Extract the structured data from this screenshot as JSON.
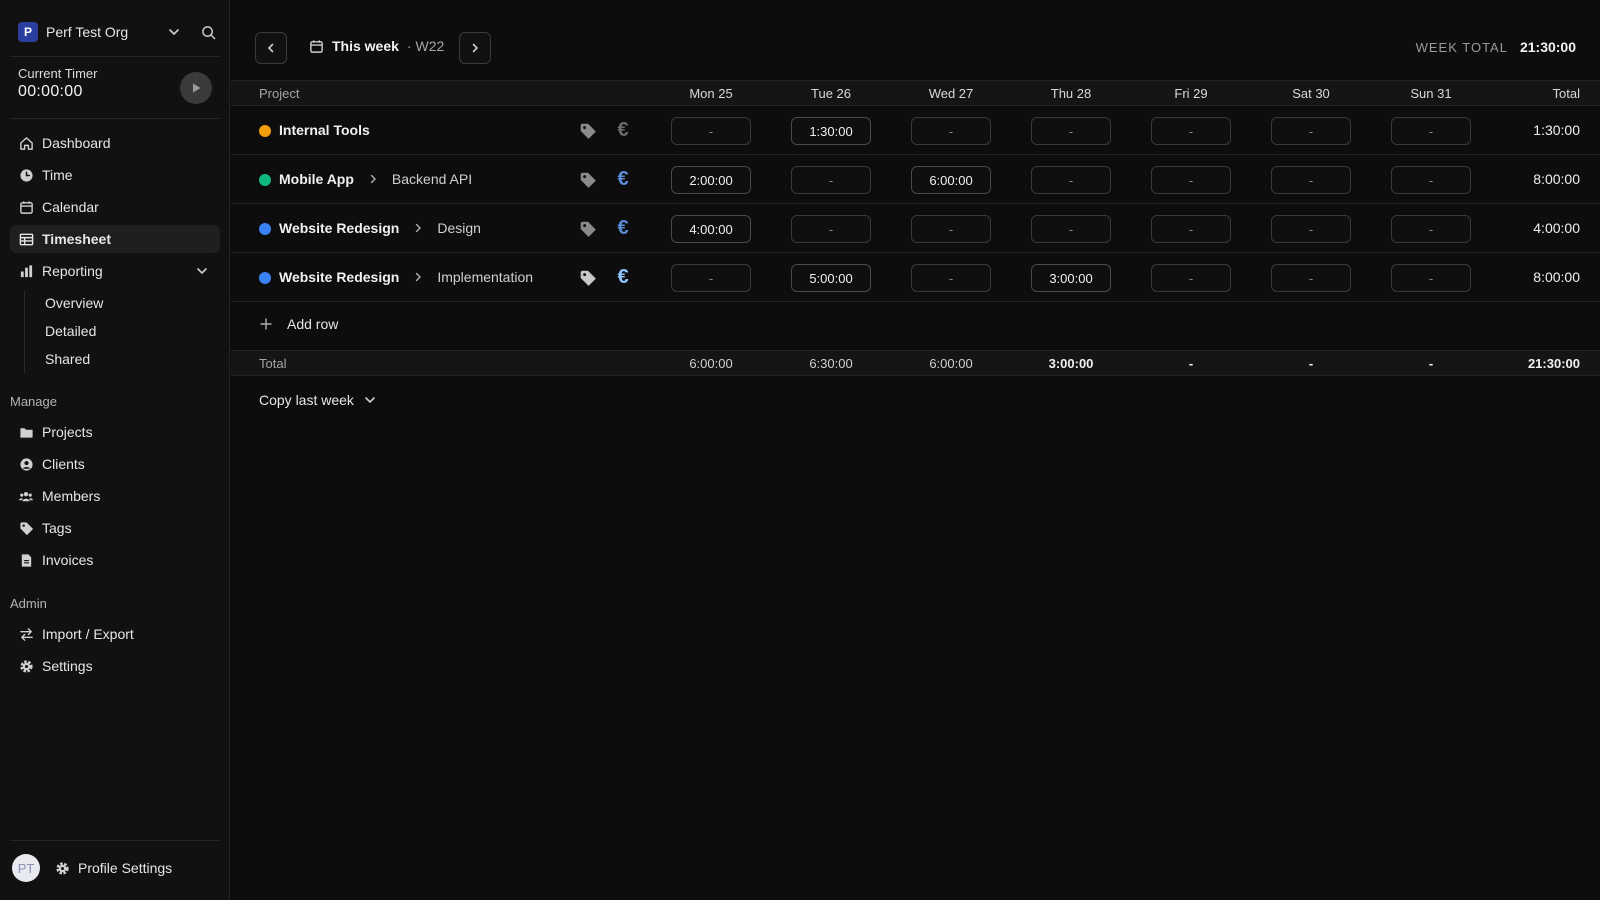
{
  "sidebar": {
    "org": {
      "badge": "P",
      "name": "Perf Test Org"
    },
    "timer": {
      "label": "Current Timer",
      "value": "00:00:00"
    },
    "nav": [
      {
        "label": "Dashboard",
        "icon": "home-icon"
      },
      {
        "label": "Time",
        "icon": "clock-icon"
      },
      {
        "label": "Calendar",
        "icon": "calendar-icon"
      },
      {
        "label": "Timesheet",
        "icon": "table-icon",
        "active": true
      },
      {
        "label": "Reporting",
        "icon": "bar-chart-icon"
      }
    ],
    "reporting_sub": [
      "Overview",
      "Detailed",
      "Shared"
    ],
    "manage_label": "Manage",
    "manage": [
      {
        "label": "Projects",
        "icon": "folder-icon"
      },
      {
        "label": "Clients",
        "icon": "user-circle-icon"
      },
      {
        "label": "Members",
        "icon": "users-icon"
      },
      {
        "label": "Tags",
        "icon": "tag-icon"
      },
      {
        "label": "Invoices",
        "icon": "file-icon"
      }
    ],
    "admin_label": "Admin",
    "admin": [
      {
        "label": "Import / Export",
        "icon": "arrows-icon"
      },
      {
        "label": "Settings",
        "icon": "gear-icon"
      }
    ],
    "profile": {
      "initials": "PT",
      "label": "Profile Settings"
    }
  },
  "header": {
    "week_label": "This week",
    "week_number": "· W22",
    "week_total_label": "WEEK TOTAL",
    "week_total_value": "21:30:00"
  },
  "table": {
    "project_header": "Project",
    "days": [
      "Mon 25",
      "Tue 26",
      "Wed 27",
      "Thu 28",
      "Fri 29",
      "Sat 30",
      "Sun 31"
    ],
    "total_header": "Total",
    "rows": [
      {
        "project": "Internal Tools",
        "task": "",
        "color": "#f59e0b",
        "billable": false,
        "cells": [
          "-",
          "1:30:00",
          "-",
          "-",
          "-",
          "-",
          "-"
        ],
        "total": "1:30:00"
      },
      {
        "project": "Mobile App",
        "task": "Backend API",
        "color": "#10b981",
        "billable": true,
        "cells": [
          "2:00:00",
          "-",
          "6:00:00",
          "-",
          "-",
          "-",
          "-"
        ],
        "total": "8:00:00"
      },
      {
        "project": "Website Redesign",
        "task": "Design",
        "color": "#3b82f6",
        "billable": true,
        "cells": [
          "4:00:00",
          "-",
          "-",
          "-",
          "-",
          "-",
          "-"
        ],
        "total": "4:00:00"
      },
      {
        "project": "Website Redesign",
        "task": "Implementation",
        "color": "#3b82f6",
        "billable": true,
        "cells": [
          "-",
          "5:00:00",
          "-",
          "3:00:00",
          "-",
          "-",
          "-"
        ],
        "total": "8:00:00"
      }
    ],
    "add_row_label": "Add row",
    "totals_label": "Total",
    "day_totals": [
      "6:00:00",
      "6:30:00",
      "6:00:00",
      "3:00:00",
      "-",
      "-",
      "-"
    ],
    "grand_total": "21:30:00"
  },
  "copy_last_week_label": "Copy last week"
}
